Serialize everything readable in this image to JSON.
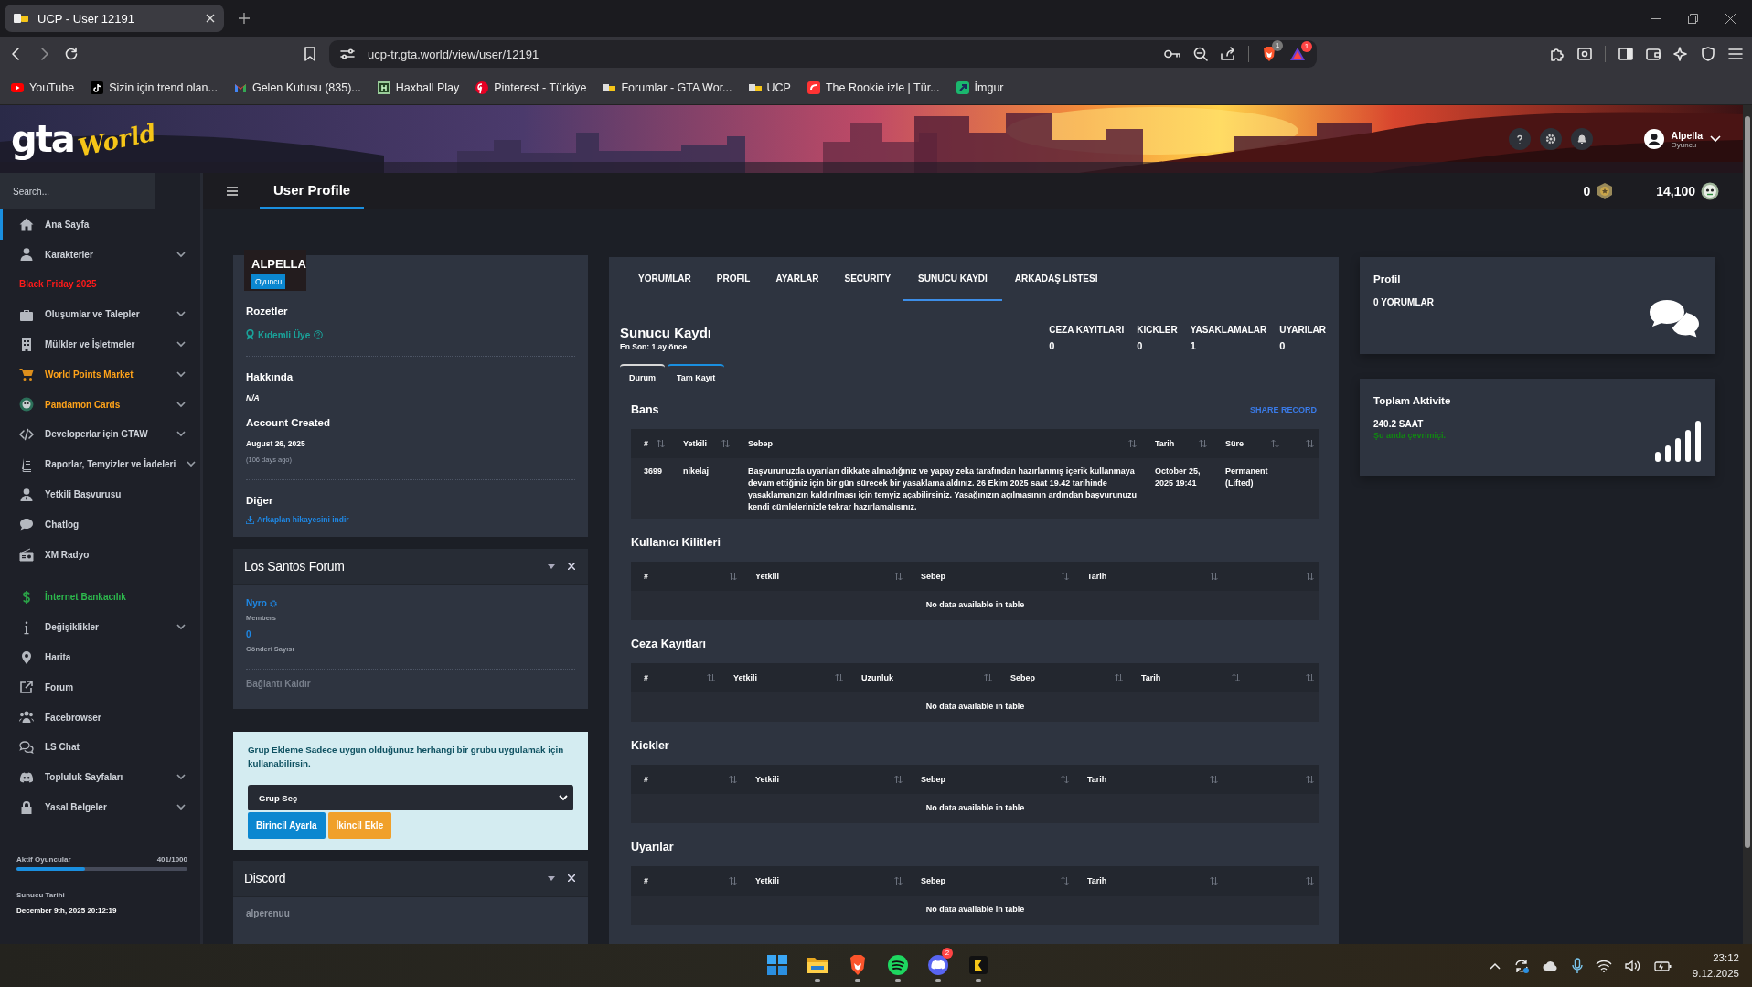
{
  "browser": {
    "tabs": [
      {
        "title": "UCP - User 12191",
        "selected": true
      }
    ],
    "url": "ucp-tr.gta.world/view/user/12191",
    "shield_count": "1",
    "alert_count": "1",
    "bookmarks": [
      {
        "label": "YouTube"
      },
      {
        "label": "Sizin için trend olan..."
      },
      {
        "label": "Gelen Kutusu (835)..."
      },
      {
        "label": "Haxball Play"
      },
      {
        "label": "Pinterest - Türkiye"
      },
      {
        "label": "Forumlar - GTA Wor..."
      },
      {
        "label": "UCP"
      },
      {
        "label": "The Rookie izle | Tür..."
      },
      {
        "label": "İmgur"
      }
    ]
  },
  "header": {
    "logo": {
      "main": "gta",
      "script": "World"
    },
    "user": {
      "name": "Alpella",
      "role": "Oyuncu"
    }
  },
  "topbar": {
    "search": {
      "placeholder": "Search..."
    },
    "title": "User Profile",
    "points": "0",
    "coins": "14,100"
  },
  "sidebar": {
    "sections": [
      {
        "items": [
          {
            "label": "Ana Sayfa",
            "selected": true,
            "expandable": false,
            "color": "#cfd3da"
          },
          {
            "label": "Karakterler",
            "selected": false,
            "expandable": true,
            "color": "#cfd3da"
          },
          {
            "label": "Black Friday 2025",
            "selected": false,
            "expandable": false,
            "color": "#ff1a1a"
          },
          {
            "label": "Oluşumlar ve Talepler",
            "selected": false,
            "expandable": true,
            "color": "#cfd3da"
          },
          {
            "label": "Mülkler ve İşletmeler",
            "selected": false,
            "expandable": true,
            "color": "#cfd3da"
          },
          {
            "label": "World Points Market",
            "selected": false,
            "expandable": true,
            "color": "#ffa31a"
          },
          {
            "label": "Pandamon Cards",
            "selected": false,
            "expandable": true,
            "color": "#ffa31a"
          },
          {
            "label": "Developerlar için GTAW",
            "selected": false,
            "expandable": true,
            "color": "#cfd3da"
          },
          {
            "label": "Raporlar, Temyizler ve İadeleri",
            "selected": false,
            "expandable": true,
            "color": "#cfd3da"
          },
          {
            "label": "Yetkili Başvurusu",
            "selected": false,
            "expandable": false,
            "color": "#cfd3da"
          },
          {
            "label": "Chatlog",
            "selected": false,
            "expandable": false,
            "color": "#cfd3da"
          },
          {
            "label": "XM Radyo",
            "selected": false,
            "expandable": false,
            "color": "#cfd3da"
          }
        ]
      },
      {
        "items": [
          {
            "label": "İnternet Bankacılık",
            "selected": false,
            "expandable": false,
            "color": "#2db84d"
          },
          {
            "label": "Değişiklikler",
            "selected": false,
            "expandable": true,
            "color": "#cfd3da"
          },
          {
            "label": "Harita",
            "selected": false,
            "expandable": false,
            "color": "#cfd3da"
          },
          {
            "label": "Forum",
            "selected": false,
            "expandable": false,
            "color": "#cfd3da"
          },
          {
            "label": "Facebrowser",
            "selected": false,
            "expandable": false,
            "color": "#cfd3da"
          },
          {
            "label": "LS Chat",
            "selected": false,
            "expandable": false,
            "color": "#cfd3da"
          },
          {
            "label": "Topluluk Sayfaları",
            "selected": false,
            "expandable": true,
            "color": "#cfd3da"
          },
          {
            "label": "Yasal Belgeler",
            "selected": false,
            "expandable": true,
            "color": "#cfd3da"
          }
        ]
      }
    ],
    "players": {
      "label": "Aktif Oyuncular",
      "count": "401/1000",
      "level": 0.401
    },
    "server_time": {
      "label": "Sunucu Tarihi",
      "value": "December 9th, 2025 20:12:19"
    }
  },
  "profile_card": {
    "name": "ALPELLA",
    "role": "Oyuncu",
    "badges_title": "Rozetler",
    "badges": [
      {
        "label": "Kıdemli Üye"
      }
    ],
    "about_title": "Hakkında",
    "about": "N/A",
    "created_title": "Account Created",
    "created": "August 26, 2025",
    "created_ago": "(106 days ago)",
    "other_title": "Diğer",
    "other_link": "Arkaplan hikayesini indir"
  },
  "forum_card": {
    "title": "Los Santos Forum",
    "user": "Nyro",
    "group": "Members",
    "posts": "0",
    "posts_label": "Gönderi Sayısı",
    "unlink": "Bağlantı Kaldır"
  },
  "group_card": {
    "text": "Grup Ekleme Sadece uygun olduğunuz herhangi bir grubu uygulamak için kullanabilirsin.",
    "select": "Grup Seç",
    "buttons": [
      {
        "label": "Birincil Ayarla",
        "kind": "primary"
      },
      {
        "label": "İkincil Ekle",
        "kind": "secondary"
      }
    ]
  },
  "discord_card": {
    "title": "Discord",
    "user": "alperenuu"
  },
  "record_panel": {
    "tabs": [
      {
        "label": "YORUMLAR",
        "selected": false
      },
      {
        "label": "PROFIL",
        "selected": false
      },
      {
        "label": "AYARLAR",
        "selected": false
      },
      {
        "label": "SECURITY",
        "selected": false
      },
      {
        "label": "SUNUCU KAYDI",
        "selected": true
      },
      {
        "label": "ARKADAŞ LISTESI",
        "selected": false
      }
    ],
    "title": "Sunucu Kaydı",
    "subtitle": "En Son: 1 ay önce",
    "stats": [
      {
        "label": "CEZA KAYITLARI",
        "value": "0"
      },
      {
        "label": "KICKLER",
        "value": "0"
      },
      {
        "label": "YASAKLAMALAR",
        "value": "1"
      },
      {
        "label": "UYARILAR",
        "value": "0"
      }
    ],
    "subtabs": [
      {
        "label": "Durum",
        "selected": false
      },
      {
        "label": "Tam Kayıt",
        "selected": true
      }
    ],
    "tables": [
      {
        "title": "Bans",
        "share": "SHARE RECORD",
        "columns": [
          "#",
          "Yetkili",
          "Sebep",
          "Tarih",
          "Süre"
        ],
        "rows": [
          [
            "3699",
            "nikelaj",
            "Başvurunuzda uyarıları dikkate almadığınız ve yapay zeka tarafından hazırlanmış içerik kullanmaya devam ettiğiniz için bir gün sürecek bir yasaklama aldınız. 26 Ekim 2025 saat 19.42 tarihinde yasaklamanızın kaldırılması için temyiz açabilirsiniz. Yasağınızın açılmasının ardından başvurunuzu kendi cümlelerinizle tekrar hazırlamalısınız.",
            "October 25, 2025 19:41",
            "Permanent (Lifted)"
          ]
        ]
      },
      {
        "title": "Kullanıcı Kilitleri",
        "columns": [
          "#",
          "Yetkili",
          "Sebep",
          "Tarih"
        ],
        "empty": "No data available in table"
      },
      {
        "title": "Ceza Kayıtları",
        "columns": [
          "#",
          "Yetkili",
          "Uzunluk",
          "Sebep",
          "Tarih"
        ],
        "empty": "No data available in table"
      },
      {
        "title": "Kickler",
        "columns": [
          "#",
          "Yetkili",
          "Sebep",
          "Tarih"
        ],
        "empty": "No data available in table"
      },
      {
        "title": "Uyarılar",
        "columns": [
          "#",
          "Yetkili",
          "Sebep",
          "Tarih"
        ],
        "empty": "No data available in table"
      }
    ]
  },
  "side_cards": [
    {
      "kind": "comments",
      "title": "Profil",
      "value": "0 YORUMLAR"
    },
    {
      "kind": "activity",
      "title": "Toplam Aktivite",
      "value": "240.2 SAAT",
      "status": "Şu anda çevrimiçi."
    }
  ],
  "taskbar": {
    "apps": [
      {
        "kind": "start",
        "running": false
      },
      {
        "kind": "files",
        "running": true
      },
      {
        "kind": "browser",
        "running": true
      },
      {
        "kind": "music",
        "running": true
      },
      {
        "kind": "chat",
        "running": true,
        "badge": "2"
      },
      {
        "kind": "app",
        "running": true
      }
    ],
    "time": "23:12",
    "date": "9.12.2025"
  }
}
